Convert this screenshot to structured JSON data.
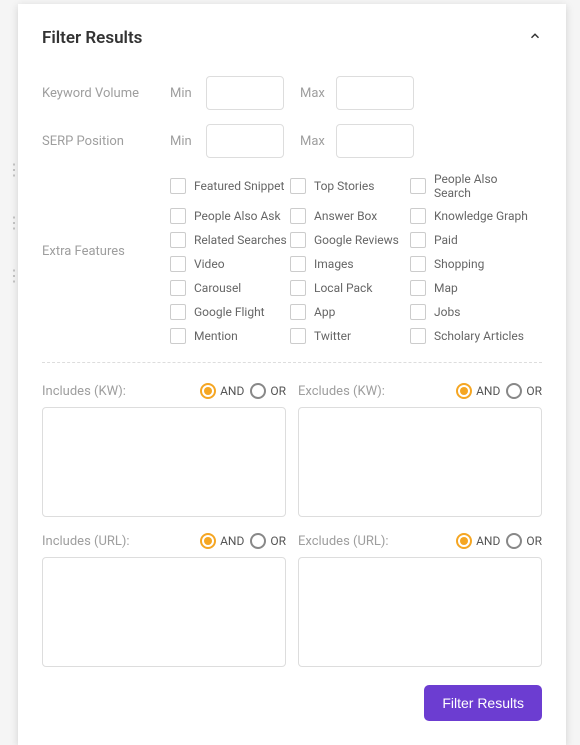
{
  "header": {
    "title": "Filter Results"
  },
  "ranges": {
    "keyword_volume": {
      "label": "Keyword Volume",
      "min_label": "Min",
      "max_label": "Max"
    },
    "serp_position": {
      "label": "SERP Position",
      "min_label": "Min",
      "max_label": "Max"
    }
  },
  "features": {
    "label": "Extra Features",
    "items": [
      "Featured Snippet",
      "Top Stories",
      "People Also Search",
      "People Also Ask",
      "Answer Box",
      "Knowledge Graph",
      "Related Searches",
      "Google Reviews",
      "Paid",
      "Video",
      "Images",
      "Shopping",
      "Carousel",
      "Local Pack",
      "Map",
      "Google Flight",
      "App",
      "Jobs",
      "Mention",
      "Twitter",
      "Scholary Articles"
    ]
  },
  "logic": {
    "and": "AND",
    "or": "OR",
    "includes_kw": {
      "label": "Includes (KW):",
      "mode": "AND"
    },
    "excludes_kw": {
      "label": "Excludes (KW):",
      "mode": "AND"
    },
    "includes_url": {
      "label": "Includes (URL):",
      "mode": "AND"
    },
    "excludes_url": {
      "label": "Excludes (URL):",
      "mode": "AND"
    }
  },
  "footer": {
    "submit": "Filter Results"
  }
}
